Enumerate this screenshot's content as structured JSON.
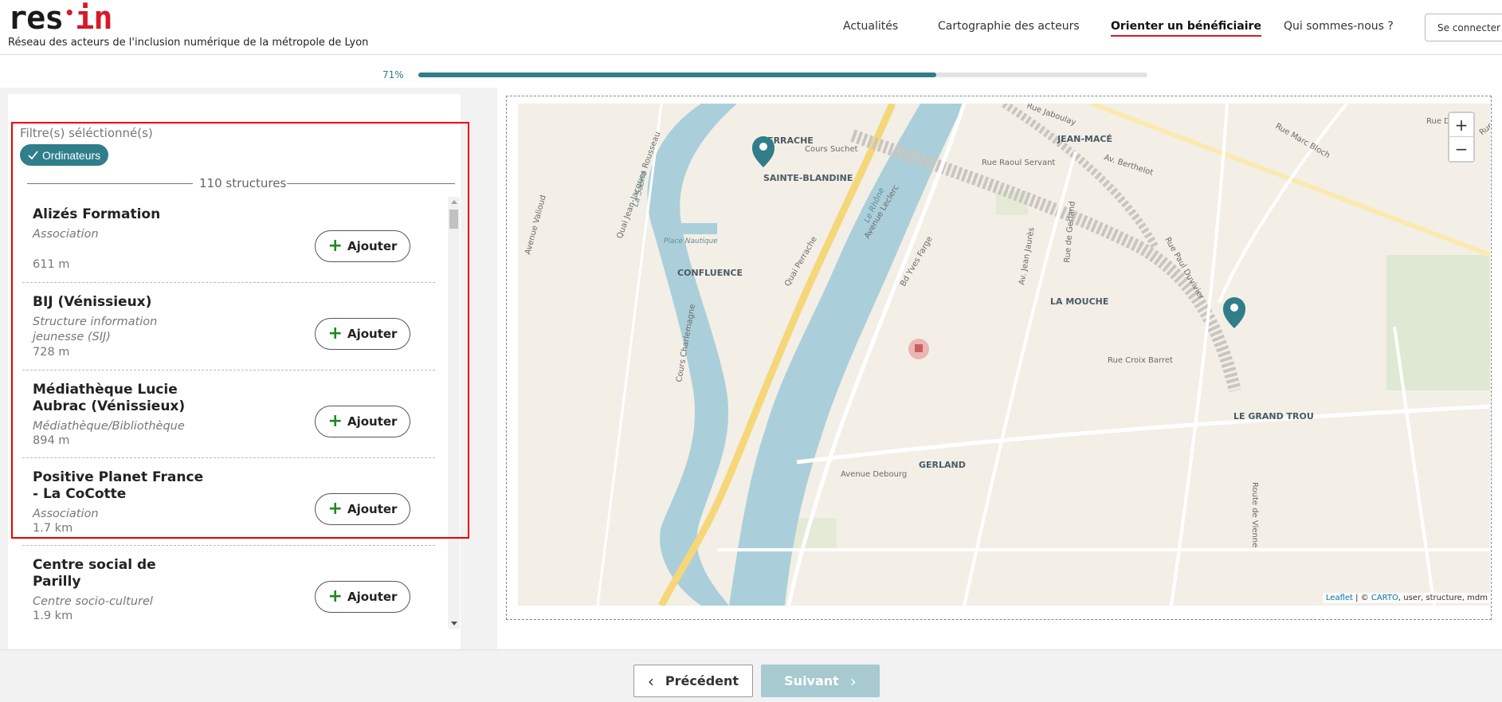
{
  "header": {
    "logo_left": "res",
    "logo_dot": "•",
    "logo_right": "in",
    "tagline": "Réseau des acteurs de l'inclusion numérique de la métropole de Lyon",
    "nav": [
      {
        "label": "Actualités",
        "active": false
      },
      {
        "label": "Cartographie des acteurs",
        "active": false
      },
      {
        "label": "Orienter un bénéficiaire",
        "active": true
      },
      {
        "label": "Qui sommes-nous ?",
        "active": false
      }
    ],
    "login_label": "Se connecter"
  },
  "progress": {
    "label": "71%",
    "value": 0.71
  },
  "filters": {
    "title": "Filtre(s) séléctionné(s)",
    "chips": [
      "Ordinateurs"
    ],
    "count_label": "110 structures"
  },
  "structures": [
    {
      "name": "Alizés Formation",
      "type": "Association",
      "distance": "611 m",
      "button": "Ajouter"
    },
    {
      "name": "BIJ (Vénissieux)",
      "type": "Structure information jeunesse (SIJ)",
      "distance": "728 m",
      "button": "Ajouter"
    },
    {
      "name": "Médiathèque Lucie Aubrac (Vénissieux)",
      "type": "Médiathèque/Bibliothèque",
      "distance": "894 m",
      "button": "Ajouter"
    },
    {
      "name": "Positive Planet France - La CoCotte",
      "type": "Association",
      "distance": "1.7 km",
      "button": "Ajouter"
    },
    {
      "name": "Centre social de Parilly",
      "type": "Centre socio-culturel",
      "distance": "1.9 km",
      "button": "Ajouter"
    }
  ],
  "map": {
    "zoom_in": "+",
    "zoom_out": "−",
    "attribution_leaflet": "Leaflet",
    "attribution_sep": " | © ",
    "attribution_carto": "CARTO",
    "attribution_rest": ", user, structure, mdm",
    "districts": [
      "PERRACHE",
      "SAINTE-BLANDINE",
      "JEAN-MACÉ",
      "CONFLUENCE",
      "LA MOUCHE",
      "GERLAND",
      "LE GRAND TROU"
    ],
    "streets": [
      "Cours Suchet",
      "Quai Perrache",
      "Avenue Leclerc",
      "Rue Raoul Servant",
      "Av. Berthelot",
      "Rue Marc Bloch",
      "Rue Domer",
      "Rue Garibaldi",
      "Quai Jean-Jacques Rousseau",
      "La Saône",
      "Le Rhône",
      "Avenue Valioud",
      "Place Nautique",
      "Cours Charlemagne",
      "Bd Yves Farge",
      "Av. Jean Jaurès",
      "Rue de Gerland",
      "Rue Paul Duvivier",
      "Rue Croix Barret",
      "Route de Vienne",
      "Avenue Debourg",
      "Rue Jaboulay"
    ],
    "colors": {
      "land": "#f3efe6",
      "water": "#aacfda",
      "highway": "#f5d77a",
      "marker": "#2f7e8a"
    }
  },
  "footer": {
    "prev_label": "Précédent",
    "next_label": "Suivant"
  }
}
